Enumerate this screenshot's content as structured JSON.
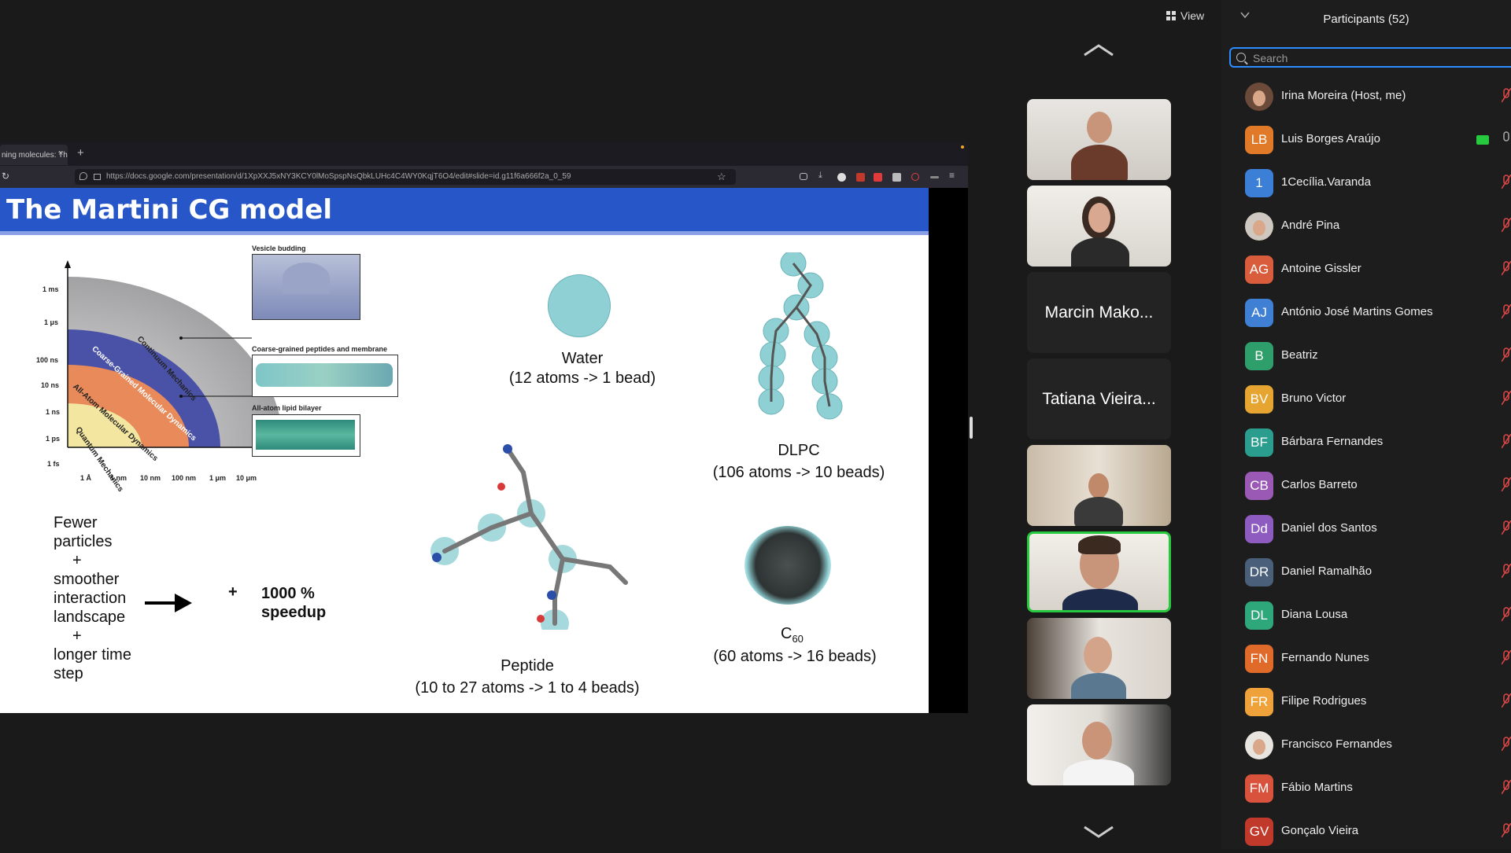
{
  "toolbar": {
    "view_label": "View"
  },
  "browser": {
    "tab_title": "ning molecules: Th",
    "tab_close": "×",
    "new_tab": "+",
    "url": "https://docs.google.com/presentation/d/1XpXXJ5xNY3KCY0lMoSpspNsQbkLUHc4C4WY0KqjT6O4/edit#slide=id.g11f6a666f2a_0_59"
  },
  "slide": {
    "title": "The Martini CG model",
    "time_ticks": [
      "1 ms",
      "1 μs",
      "100 ns",
      "10 ns",
      "1 ns",
      "1 ps",
      "1 fs"
    ],
    "length_ticks": [
      "1 Å",
      "1 nm",
      "10 nm",
      "100 nm",
      "1 μm",
      "10 μm"
    ],
    "arc_labels": [
      "Continuum Mechanics",
      "Coarse-Grained Molecular Dynamics",
      "All-Atom Molecular Dynamics",
      "Quantum Mechanics"
    ],
    "inset_labels": [
      "Vesicle budding",
      "Coarse-grained peptides and membrane",
      "All-atom lipid bilayer"
    ],
    "water_name": "Water",
    "water_desc": "(12 atoms -> 1 bead)",
    "dlpc_name": "DLPC",
    "dlpc_desc": "(106 atoms -> 10 beads)",
    "peptide_name": "Peptide",
    "peptide_desc": "(10 to 27 atoms -> 1 to 4 beads)",
    "c60_name": "C",
    "c60_sub": "60",
    "c60_desc": "(60 atoms -> 16 beads)",
    "left_text": [
      "Fewer",
      "particles",
      "+",
      "smoother",
      "interaction",
      "landscape",
      "+",
      "longer time",
      "step"
    ],
    "plus": "+",
    "speedup_1": "1000 %",
    "speedup_2": "speedup"
  },
  "tiles": {
    "name_tile_1": "Marcin Mako...",
    "name_tile_2": "Tatiana Vieira..."
  },
  "participants": {
    "title": "Participants (52)",
    "search_placeholder": "Search",
    "list": [
      {
        "initials": "",
        "name": "Irina Moreira (Host, me)",
        "color": "#6b4a3a"
      },
      {
        "initials": "LB",
        "name": "Luis Borges Araújo",
        "color": "#e07a28"
      },
      {
        "initials": "1",
        "name": "1Cecília.Varanda",
        "color": "#3b7fd6"
      },
      {
        "initials": "",
        "name": "André Pina",
        "color": "#cfc8c0"
      },
      {
        "initials": "AG",
        "name": "Antoine Gissler",
        "color": "#d95c3c"
      },
      {
        "initials": "AJ",
        "name": "António José Martins Gomes",
        "color": "#3f7fd4"
      },
      {
        "initials": "B",
        "name": "Beatriz",
        "color": "#2e9e6a"
      },
      {
        "initials": "BV",
        "name": "Bruno Victor",
        "color": "#e6a430"
      },
      {
        "initials": "BF",
        "name": "Bárbara Fernandes",
        "color": "#2a9d8f"
      },
      {
        "initials": "CB",
        "name": "Carlos Barreto",
        "color": "#9b59b6"
      },
      {
        "initials": "Dd",
        "name": "Daniel dos Santos",
        "color": "#8e5bc0"
      },
      {
        "initials": "DR",
        "name": "Daniel Ramalhão",
        "color": "#4a5f7a"
      },
      {
        "initials": "DL",
        "name": "Diana Lousa",
        "color": "#2ea87a"
      },
      {
        "initials": "FN",
        "name": "Fernando Nunes",
        "color": "#e06a2a"
      },
      {
        "initials": "FR",
        "name": "Filipe Rodrigues",
        "color": "#f0a23a"
      },
      {
        "initials": "",
        "name": "Francisco Fernandes",
        "color": "#e8e4df"
      },
      {
        "initials": "FM",
        "name": "Fábio Martins",
        "color": "#d9523c"
      },
      {
        "initials": "GV",
        "name": "Gonçalo Vieira",
        "color": "#c0392b"
      }
    ]
  }
}
